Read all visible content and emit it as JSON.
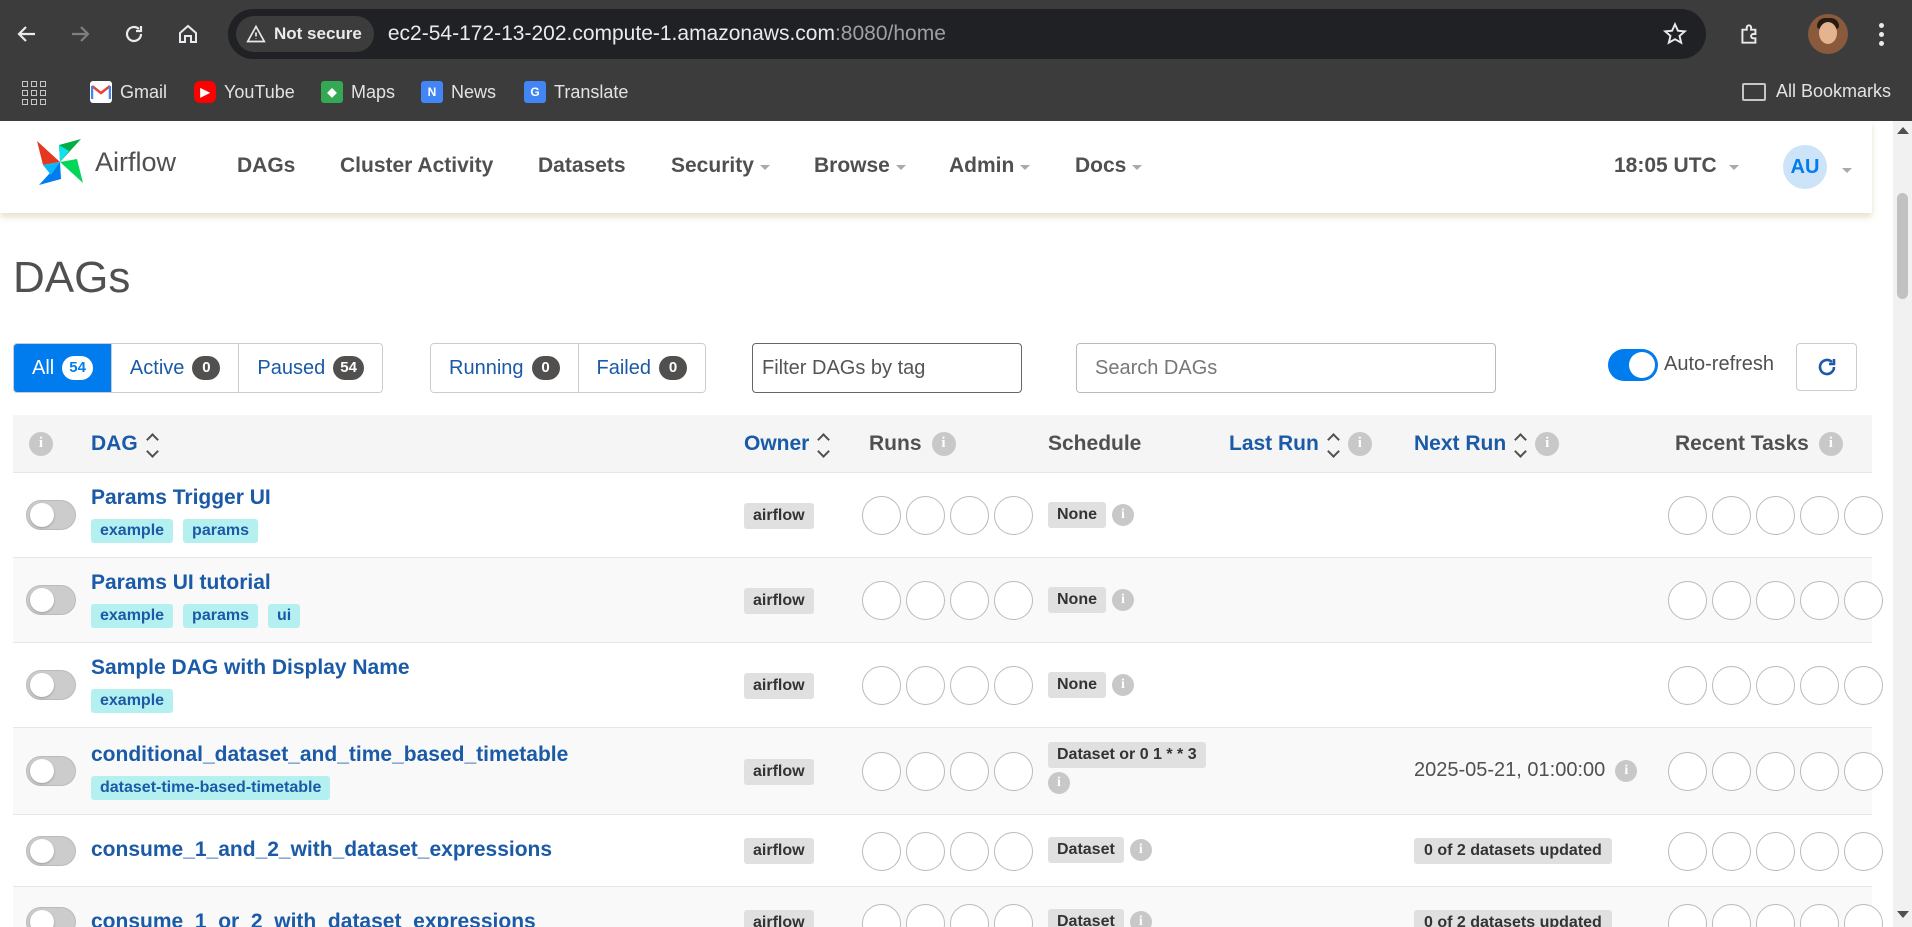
{
  "browser": {
    "security_label": "Not secure",
    "url_host": "ec2-54-172-13-202.compute-1.amazonaws.com",
    "url_rest": ":8080/home",
    "bookmarks": [
      {
        "label": "Gmail",
        "icon": "gmail-icon",
        "color": "#ea4335"
      },
      {
        "label": "YouTube",
        "icon": "youtube-icon",
        "color": "#ff0000"
      },
      {
        "label": "Maps",
        "icon": "maps-icon",
        "color": "#34a853"
      },
      {
        "label": "News",
        "icon": "news-icon",
        "color": "#4285f4"
      },
      {
        "label": "Translate",
        "icon": "translate-icon",
        "color": "#4285f4"
      }
    ],
    "all_bookmarks": "All Bookmarks"
  },
  "app": {
    "logo_text": "Airflow",
    "nav": [
      "DAGs",
      "Cluster Activity",
      "Datasets",
      "Security",
      "Browse",
      "Admin",
      "Docs"
    ],
    "clock": "18:05 UTC",
    "avatar": "AU",
    "accent": "#017cee",
    "link_color": "#1a5aa7"
  },
  "page": {
    "title": "DAGs",
    "filters": {
      "all": {
        "label": "All",
        "count": "54"
      },
      "active": {
        "label": "Active",
        "count": "0"
      },
      "paused": {
        "label": "Paused",
        "count": "54"
      },
      "running": {
        "label": "Running",
        "count": "0"
      },
      "failed": {
        "label": "Failed",
        "count": "0"
      }
    },
    "tag_filter_placeholder": "Filter DAGs by tag",
    "search_placeholder": "Search DAGs",
    "auto_refresh": "Auto-refresh"
  },
  "table": {
    "headers": {
      "dag": "DAG",
      "owner": "Owner",
      "runs": "Runs",
      "schedule": "Schedule",
      "last_run": "Last Run",
      "next_run": "Next Run",
      "recent_tasks": "Recent Tasks"
    },
    "rows": [
      {
        "name": "Params Trigger UI",
        "tags": [
          "example",
          "params"
        ],
        "owner": "airflow",
        "schedule": "None",
        "next_run": "",
        "next_badge": ""
      },
      {
        "name": "Params UI tutorial",
        "tags": [
          "example",
          "params",
          "ui"
        ],
        "owner": "airflow",
        "schedule": "None",
        "next_run": "",
        "next_badge": ""
      },
      {
        "name": "Sample DAG with Display Name",
        "tags": [
          "example"
        ],
        "owner": "airflow",
        "schedule": "None",
        "next_run": "",
        "next_badge": ""
      },
      {
        "name": "conditional_dataset_and_time_based_timetable",
        "tags": [
          "dataset-time-based-timetable"
        ],
        "owner": "airflow",
        "schedule": "Dataset or 0 1 * * 3",
        "next_run": "2025-05-21, 01:00:00",
        "next_badge": ""
      },
      {
        "name": "consume_1_and_2_with_dataset_expressions",
        "tags": [],
        "owner": "airflow",
        "schedule": "Dataset",
        "next_run": "",
        "next_badge": "0 of 2 datasets updated"
      },
      {
        "name": "consume_1_or_2_with_dataset_expressions",
        "tags": [],
        "owner": "airflow",
        "schedule": "Dataset",
        "next_run": "",
        "next_badge": "0 of 2 datasets updated"
      }
    ]
  }
}
